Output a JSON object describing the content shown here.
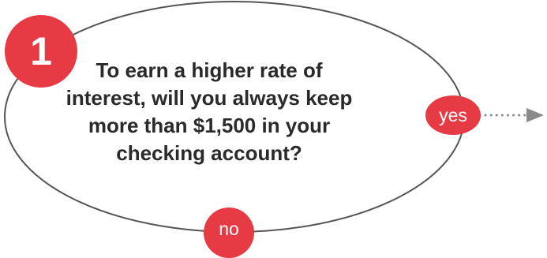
{
  "step": {
    "number": "1"
  },
  "question": {
    "text": "To earn a higher rate of interest, will you always keep more than $1,500 in your checking account?"
  },
  "answers": {
    "yes": "yes",
    "no": "no"
  },
  "colors": {
    "accent": "#e63b45",
    "outline": "#555555",
    "arrow": "#8a8a8a",
    "text": "#2a2a2a"
  },
  "icons": {
    "next": "dotted-arrow-right-icon"
  }
}
